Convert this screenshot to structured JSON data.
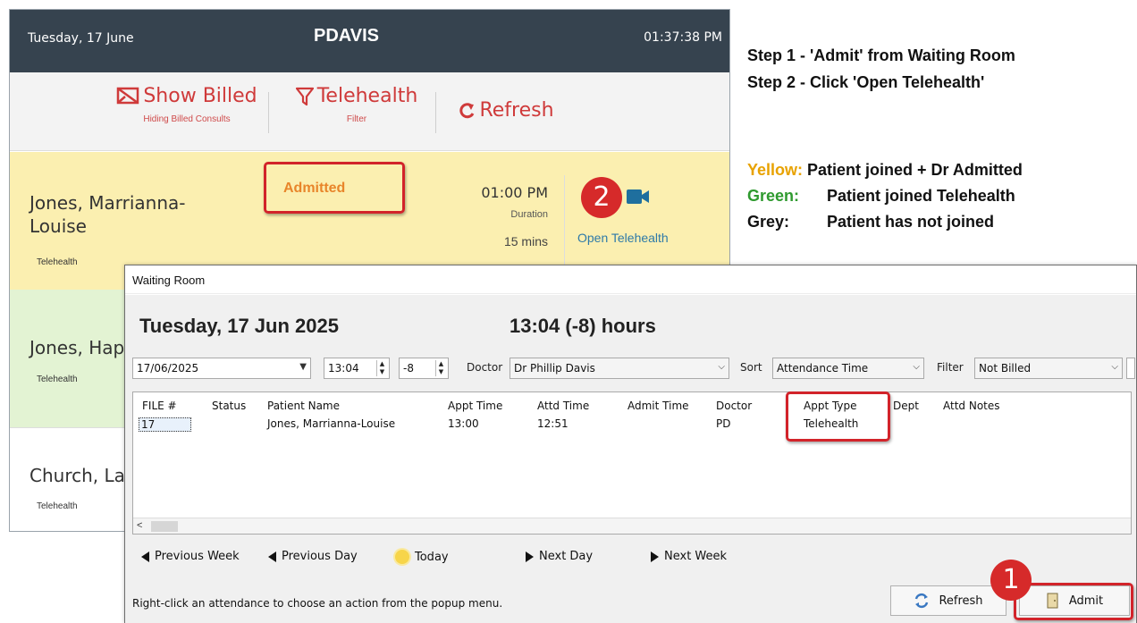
{
  "telehealth": {
    "date": "Tuesday, 17 June",
    "user": "PDAVIS",
    "time": "01:37:38 PM",
    "toolbar": {
      "show_billed": "Show Billed",
      "show_billed_sub": "Hiding Billed Consults",
      "telehealth": "Telehealth",
      "telehealth_sub": "Filter",
      "refresh": "Refresh"
    },
    "patients": [
      {
        "name_line1": "Jones, Marrianna-",
        "name_line2": "Louise",
        "type": "Telehealth",
        "status": "Admitted",
        "appt_time": "01:00 PM",
        "duration_label": "Duration",
        "duration": "15 mins",
        "action": "Open Telehealth"
      },
      {
        "name": "Jones, Hap",
        "type": "Telehealth"
      },
      {
        "name": "Church, La",
        "type": "Telehealth"
      }
    ],
    "colors": {
      "header": "#36434f",
      "accent_red": "#cf3a3a",
      "yellow_row": "#fbefb0",
      "green_row": "#e3f3d3",
      "link_blue": "#2e7aa8"
    }
  },
  "instructions": {
    "step1": "Step 1 - 'Admit' from Waiting Room",
    "step2": "Step 2 - Click 'Open Telehealth'",
    "legend": [
      {
        "key": "Yellow:",
        "text": "Patient joined + Dr Admitted",
        "color": "#e8a200"
      },
      {
        "key": "Green:",
        "text": "Patient joined Telehealth",
        "color": "#2f9a2f"
      },
      {
        "key": "Grey:",
        "text": "Patient has not joined",
        "color": "#111111"
      }
    ]
  },
  "waiting_room": {
    "title": "Waiting Room",
    "date_heading": "Tuesday, 17 Jun 2025",
    "hours_heading": "13:04 (-8)  hours",
    "controls": {
      "date": "17/06/2025",
      "time": "13:04",
      "offset": "-8",
      "doctor_label": "Doctor",
      "doctor": "Dr Phillip Davis",
      "sort_label": "Sort",
      "sort": "Attendance Time",
      "filter_label": "Filter",
      "filter": "Not Billed"
    },
    "columns": [
      "FILE #",
      "Status",
      "Patient Name",
      "Appt Time",
      "Attd Time",
      "Admit Time",
      "Doctor",
      "Appt Type",
      "Dept",
      "Attd Notes"
    ],
    "rows": [
      {
        "file": "17",
        "status": "",
        "patient": "Jones, Marrianna-Louise",
        "appt_time": "13:00",
        "attd_time": "12:51",
        "admit_time": "",
        "doctor": "PD",
        "appt_type": "Telehealth",
        "dept": "",
        "notes": ""
      }
    ],
    "nav": {
      "prev_week": "Previous Week",
      "prev_day": "Previous Day",
      "today": "Today",
      "next_day": "Next Day",
      "next_week": "Next Week"
    },
    "footer_message": "Right-click an attendance to choose an action from the popup menu.",
    "refresh_button": "Refresh",
    "admit_button": "Admit"
  },
  "badges": {
    "step_one": "1",
    "step_two": "2"
  }
}
